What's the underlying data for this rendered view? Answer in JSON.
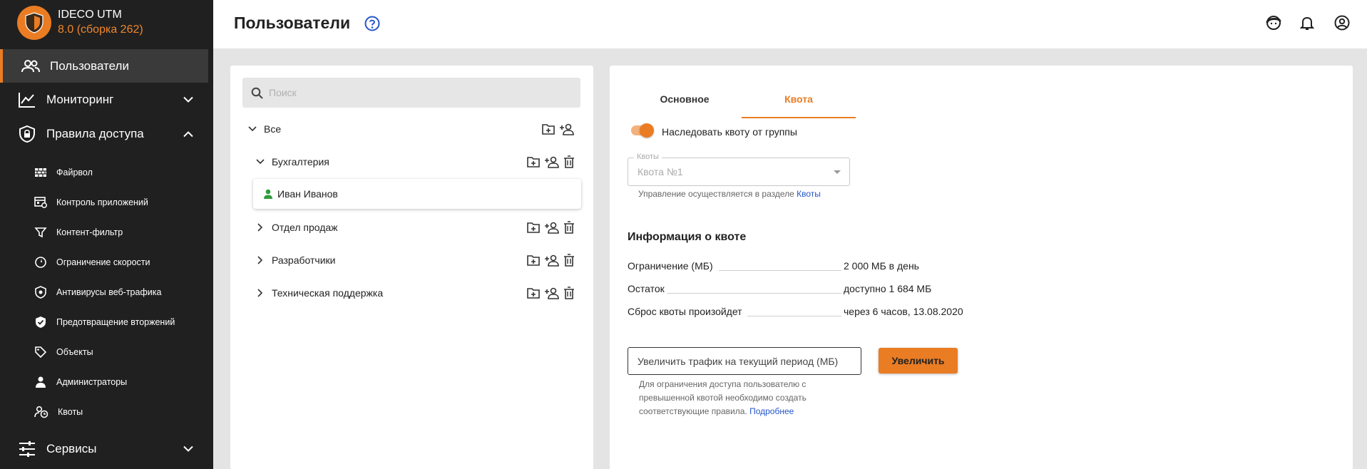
{
  "brand": {
    "name": "IDECO UTM",
    "version": "8.0 (сборка 262)"
  },
  "sidebar": {
    "active": "Пользователи",
    "monitoring": "Мониторинг",
    "access_rules": "Правила доступа",
    "sub_items": [
      {
        "label": "Файрвол",
        "icon": "firewall-icon"
      },
      {
        "label": "Контроль приложений",
        "icon": "app-control-icon"
      },
      {
        "label": "Контент-фильтр",
        "icon": "filter-icon"
      },
      {
        "label": "Ограничение скорости",
        "icon": "speed-limit-icon"
      },
      {
        "label": "Антивирусы веб-трафика",
        "icon": "antivirus-shield-icon"
      },
      {
        "label": "Предотвращение вторжений",
        "icon": "shield-check-icon"
      },
      {
        "label": "Объекты",
        "icon": "tag-icon"
      },
      {
        "label": "Администраторы",
        "icon": "admin-icon"
      },
      {
        "label": "Квоты",
        "icon": "quota-user-clock-icon"
      }
    ],
    "services": "Сервисы"
  },
  "header": {
    "title": "Пользователи"
  },
  "tree": {
    "search_placeholder": "Поиск",
    "root": "Все",
    "groups": [
      {
        "name": "Бухгалтерия",
        "expanded": true
      },
      {
        "name": "Отдел продаж",
        "expanded": false
      },
      {
        "name": "Разработчики",
        "expanded": false
      },
      {
        "name": "Техническая поддержка",
        "expanded": false
      }
    ],
    "selected_user": "Иван Иванов"
  },
  "quota": {
    "tabs": [
      "Основное",
      "Квота"
    ],
    "active_tab": "Квота",
    "inherit_label": "Наследовать квоту от группы",
    "inherit_enabled": true,
    "select_legend": "Квоты",
    "select_value": "Квота №1",
    "hint_text": "Управление осуществляется в разделе ",
    "hint_link": "Квоты",
    "info_title": "Информация о квоте",
    "info": [
      {
        "key": "Ограничение (МБ)",
        "value": "2 000 МБ в день"
      },
      {
        "key": "Остаток",
        "value": "доступно 1 684 МБ"
      },
      {
        "key": "Сброс квоты произойдет",
        "value": "через 6 часов, 13.08.2020"
      }
    ],
    "increase_placeholder": "Увеличить трафик на текущий период (МБ)",
    "increase_button": "Увеличить",
    "note_text": "Для ограничения доступа пользователю с превышенной квотой необходимо создать соответствующие правила. ",
    "note_link": "Подробнее"
  },
  "colors": {
    "accent": "#ea7c23",
    "sidebar_bg": "#202020",
    "link": "#2456c8",
    "user_green": "#2e9d3c"
  }
}
